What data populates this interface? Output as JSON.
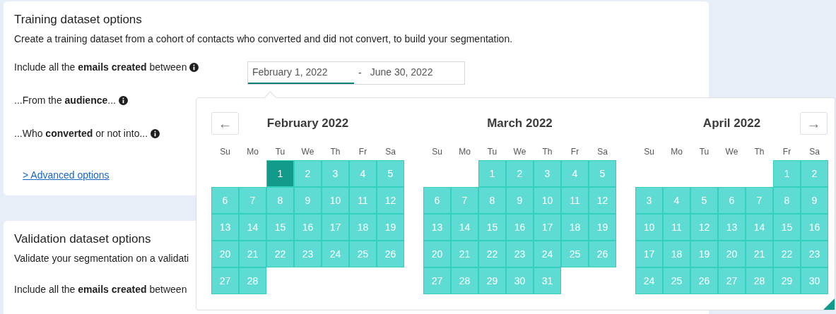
{
  "training": {
    "title": "Training dataset options",
    "description": "Create a training dataset from a cohort of contacts who converted and did not convert, to build your segmentation.",
    "rows": [
      {
        "label": "Include all the **emails created** between",
        "info": true
      },
      {
        "label": "...From the **audience**...",
        "info": true
      },
      {
        "label": "...Who **converted** or not into...",
        "info": true
      }
    ],
    "date_range": {
      "inputs": [
        {
          "value": "February 1, 2022",
          "focused": true
        },
        {
          "value": "June 30, 2022",
          "focused": false
        }
      ],
      "separator": "-"
    },
    "advanced_link": "> Advanced options"
  },
  "validation": {
    "title": "Validation dataset options",
    "description": "Validate your segmentation on a validati",
    "rows": [
      {
        "label": "Include all the **emails created** between"
      }
    ]
  },
  "datepicker": {
    "prev": "←",
    "next": "→",
    "months": [
      {
        "title": "February 2022",
        "weekdays": [
          "Su",
          "Mo",
          "Tu",
          "We",
          "Th",
          "Fr",
          "Sa"
        ],
        "cells": [
          {
            "kind": "empty"
          },
          {
            "kind": "empty"
          },
          {
            "kind": "day",
            "label": "1",
            "selected": true
          },
          {
            "kind": "day",
            "label": "2",
            "selected": false
          },
          {
            "kind": "day",
            "label": "3",
            "selected": false
          },
          {
            "kind": "day",
            "label": "4",
            "selected": false
          },
          {
            "kind": "day",
            "label": "5",
            "selected": false
          },
          {
            "kind": "day",
            "label": "6",
            "selected": false
          },
          {
            "kind": "day",
            "label": "7",
            "selected": false
          },
          {
            "kind": "day",
            "label": "8",
            "selected": false
          },
          {
            "kind": "day",
            "label": "9",
            "selected": false
          },
          {
            "kind": "day",
            "label": "10",
            "selected": false
          },
          {
            "kind": "day",
            "label": "11",
            "selected": false
          },
          {
            "kind": "day",
            "label": "12",
            "selected": false
          },
          {
            "kind": "day",
            "label": "13",
            "selected": false
          },
          {
            "kind": "day",
            "label": "14",
            "selected": false
          },
          {
            "kind": "day",
            "label": "15",
            "selected": false
          },
          {
            "kind": "day",
            "label": "16",
            "selected": false
          },
          {
            "kind": "day",
            "label": "17",
            "selected": false
          },
          {
            "kind": "day",
            "label": "18",
            "selected": false
          },
          {
            "kind": "day",
            "label": "19",
            "selected": false
          },
          {
            "kind": "day",
            "label": "20",
            "selected": false
          },
          {
            "kind": "day",
            "label": "21",
            "selected": false
          },
          {
            "kind": "day",
            "label": "22",
            "selected": false
          },
          {
            "kind": "day",
            "label": "23",
            "selected": false
          },
          {
            "kind": "day",
            "label": "24",
            "selected": false
          },
          {
            "kind": "day",
            "label": "25",
            "selected": false
          },
          {
            "kind": "day",
            "label": "26",
            "selected": false
          },
          {
            "kind": "day",
            "label": "27",
            "selected": false
          },
          {
            "kind": "day",
            "label": "28",
            "selected": false
          }
        ]
      },
      {
        "title": "March 2022",
        "weekdays": [
          "Su",
          "Mo",
          "Tu",
          "We",
          "Th",
          "Fr",
          "Sa"
        ],
        "cells": [
          {
            "kind": "empty"
          },
          {
            "kind": "empty"
          },
          {
            "kind": "day",
            "label": "1",
            "selected": false
          },
          {
            "kind": "day",
            "label": "2",
            "selected": false
          },
          {
            "kind": "day",
            "label": "3",
            "selected": false
          },
          {
            "kind": "day",
            "label": "4",
            "selected": false
          },
          {
            "kind": "day",
            "label": "5",
            "selected": false
          },
          {
            "kind": "day",
            "label": "6",
            "selected": false
          },
          {
            "kind": "day",
            "label": "7",
            "selected": false
          },
          {
            "kind": "day",
            "label": "8",
            "selected": false
          },
          {
            "kind": "day",
            "label": "9",
            "selected": false
          },
          {
            "kind": "day",
            "label": "10",
            "selected": false
          },
          {
            "kind": "day",
            "label": "11",
            "selected": false
          },
          {
            "kind": "day",
            "label": "12",
            "selected": false
          },
          {
            "kind": "day",
            "label": "13",
            "selected": false
          },
          {
            "kind": "day",
            "label": "14",
            "selected": false
          },
          {
            "kind": "day",
            "label": "15",
            "selected": false
          },
          {
            "kind": "day",
            "label": "16",
            "selected": false
          },
          {
            "kind": "day",
            "label": "17",
            "selected": false
          },
          {
            "kind": "day",
            "label": "18",
            "selected": false
          },
          {
            "kind": "day",
            "label": "19",
            "selected": false
          },
          {
            "kind": "day",
            "label": "20",
            "selected": false
          },
          {
            "kind": "day",
            "label": "21",
            "selected": false
          },
          {
            "kind": "day",
            "label": "22",
            "selected": false
          },
          {
            "kind": "day",
            "label": "23",
            "selected": false
          },
          {
            "kind": "day",
            "label": "24",
            "selected": false
          },
          {
            "kind": "day",
            "label": "25",
            "selected": false
          },
          {
            "kind": "day",
            "label": "26",
            "selected": false
          },
          {
            "kind": "day",
            "label": "27",
            "selected": false
          },
          {
            "kind": "day",
            "label": "28",
            "selected": false
          },
          {
            "kind": "day",
            "label": "29",
            "selected": false
          },
          {
            "kind": "day",
            "label": "30",
            "selected": false
          },
          {
            "kind": "day",
            "label": "31",
            "selected": false
          }
        ]
      },
      {
        "title": "April 2022",
        "weekdays": [
          "Su",
          "Mo",
          "Tu",
          "We",
          "Th",
          "Fr",
          "Sa"
        ],
        "cells": [
          {
            "kind": "empty"
          },
          {
            "kind": "empty"
          },
          {
            "kind": "empty"
          },
          {
            "kind": "empty"
          },
          {
            "kind": "empty"
          },
          {
            "kind": "day",
            "label": "1",
            "selected": false
          },
          {
            "kind": "day",
            "label": "2",
            "selected": false
          },
          {
            "kind": "day",
            "label": "3",
            "selected": false
          },
          {
            "kind": "day",
            "label": "4",
            "selected": false
          },
          {
            "kind": "day",
            "label": "5",
            "selected": false
          },
          {
            "kind": "day",
            "label": "6",
            "selected": false
          },
          {
            "kind": "day",
            "label": "7",
            "selected": false
          },
          {
            "kind": "day",
            "label": "8",
            "selected": false
          },
          {
            "kind": "day",
            "label": "9",
            "selected": false
          },
          {
            "kind": "day",
            "label": "10",
            "selected": false
          },
          {
            "kind": "day",
            "label": "11",
            "selected": false
          },
          {
            "kind": "day",
            "label": "12",
            "selected": false
          },
          {
            "kind": "day",
            "label": "13",
            "selected": false
          },
          {
            "kind": "day",
            "label": "14",
            "selected": false
          },
          {
            "kind": "day",
            "label": "15",
            "selected": false
          },
          {
            "kind": "day",
            "label": "16",
            "selected": false
          },
          {
            "kind": "day",
            "label": "17",
            "selected": false
          },
          {
            "kind": "day",
            "label": "18",
            "selected": false
          },
          {
            "kind": "day",
            "label": "19",
            "selected": false
          },
          {
            "kind": "day",
            "label": "20",
            "selected": false
          },
          {
            "kind": "day",
            "label": "21",
            "selected": false
          },
          {
            "kind": "day",
            "label": "22",
            "selected": false
          },
          {
            "kind": "day",
            "label": "23",
            "selected": false
          },
          {
            "kind": "day",
            "label": "24",
            "selected": false
          },
          {
            "kind": "day",
            "label": "25",
            "selected": false
          },
          {
            "kind": "day",
            "label": "26",
            "selected": false
          },
          {
            "kind": "day",
            "label": "27",
            "selected": false
          },
          {
            "kind": "day",
            "label": "28",
            "selected": false
          },
          {
            "kind": "day",
            "label": "29",
            "selected": false
          },
          {
            "kind": "day",
            "label": "30",
            "selected": false
          }
        ]
      }
    ]
  }
}
